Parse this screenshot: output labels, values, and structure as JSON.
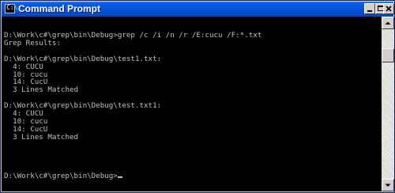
{
  "window": {
    "title": "Command Prompt",
    "icon": "console-icon",
    "icon_glyph": "C:\\"
  },
  "titlebar_buttons": [
    {
      "name": "minimize-button",
      "icon": "minimize-icon"
    },
    {
      "name": "maximize-button",
      "icon": "maximize-icon"
    },
    {
      "name": "close-button",
      "icon": "close-icon"
    }
  ],
  "console": {
    "background": "#000000",
    "foreground": "#c0c0c0",
    "lines": [
      "D:\\Work\\c#\\grep\\bin\\Debug>grep /c /i /n /r /E:cucu /F:*.txt",
      "Grep Results:",
      "",
      "D:\\Work\\c#\\grep\\bin\\Debug\\test1.txt:",
      "  4: CUCU",
      "  10: cucu",
      "  14: CucU",
      "  3 Lines Matched",
      "",
      "D:\\Work\\c#\\grep\\bin\\Debug\\test.txt1:",
      "  4: CUCU",
      "  10: cucu",
      "  14: CucU",
      "  3 Lines Matched",
      "",
      "",
      "",
      ""
    ],
    "prompt": "D:\\Work\\c#\\grep\\bin\\Debug>"
  },
  "scrollbar": {
    "up_icon": "scroll-up-arrow-icon",
    "down_icon": "scroll-down-arrow-icon"
  }
}
